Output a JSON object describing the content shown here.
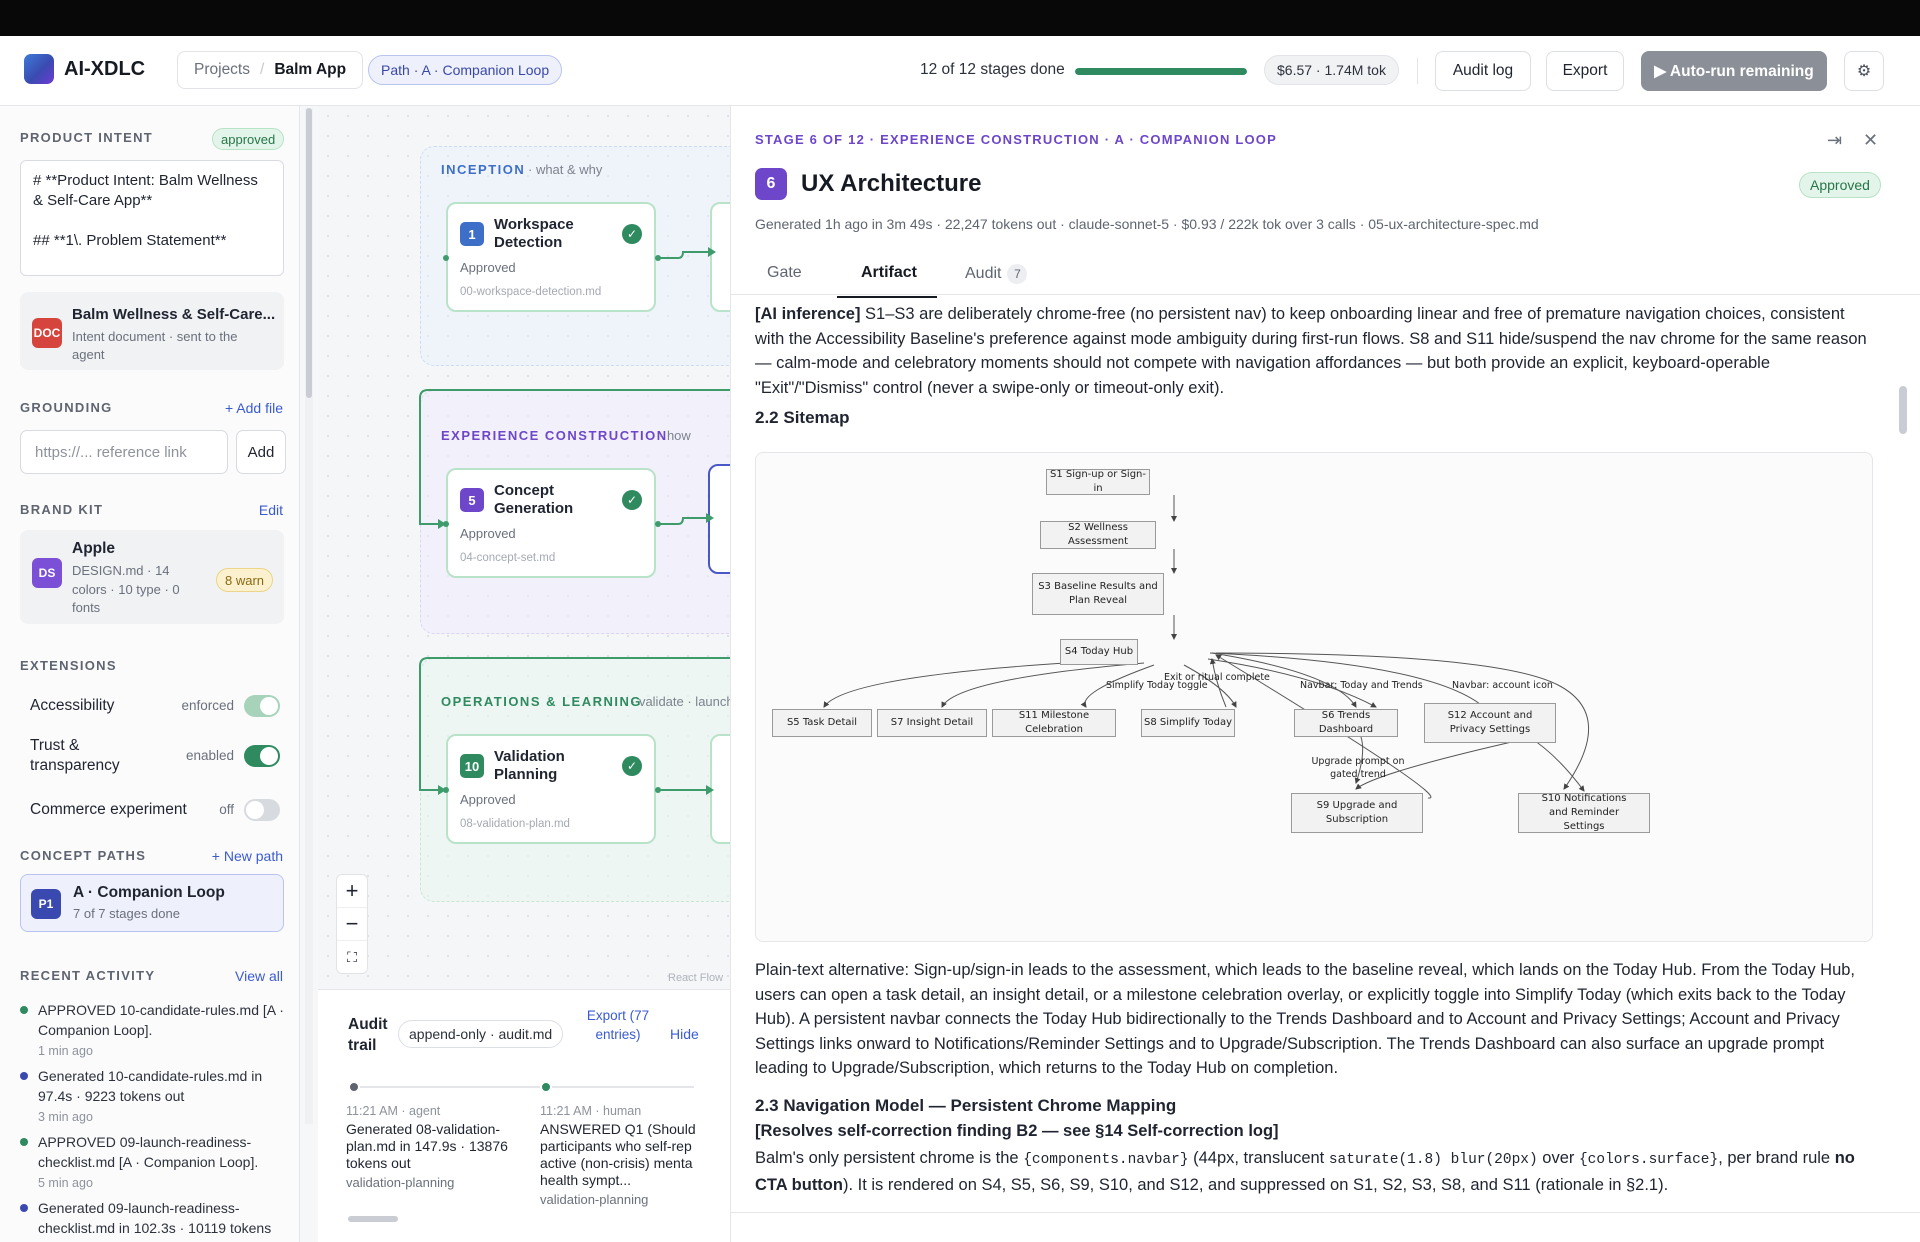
{
  "app": {
    "name": "AI-XDLC"
  },
  "breadcrumb": {
    "projects": "Projects",
    "sep": "/",
    "current": "Balm App"
  },
  "path_pill": "Path · A · Companion Loop",
  "progress": {
    "label": "12 of 12 stages done",
    "fraction": 1.0
  },
  "cost": "$6.57 · 1.74M tok",
  "header_buttons": {
    "audit_log": "Audit log",
    "export": "Export",
    "auto_run": "▶ Auto-run remaining",
    "settings_icon": "⚙"
  },
  "sidebar": {
    "product_intent": {
      "title": "PRODUCT INTENT",
      "badge": "approved",
      "text": "# **Product Intent: Balm Wellness & Self-Care App**\n\n## **1\\. Problem Statement**",
      "doc_icon": "DOC",
      "doc_title": "Balm Wellness & Self-Care...",
      "doc_sub": "Intent document · sent to the agent"
    },
    "grounding": {
      "title": "GROUNDING",
      "add_file": "+ Add file",
      "placeholder": "https://... reference link",
      "add_label": "Add"
    },
    "brand_kit": {
      "title": "BRAND KIT",
      "edit": "Edit",
      "icon": "DS",
      "name": "Apple",
      "sub": "DESIGN.md · 14 colors · 10 type · 0 fonts",
      "warn": "8 warn"
    },
    "extensions": {
      "title": "EXTENSIONS",
      "items": [
        {
          "label": "Accessibility",
          "status": "enforced"
        },
        {
          "label": "Trust & transparency",
          "status": "enabled"
        },
        {
          "label": "Commerce experiment",
          "status": "off"
        }
      ]
    },
    "concept_paths": {
      "title": "CONCEPT PATHS",
      "new_path": "+ New path",
      "icon": "P1",
      "name": "A · Companion Loop",
      "sub": "7 of 7 stages done"
    },
    "recent_activity": {
      "title": "RECENT ACTIVITY",
      "view_all": "View all",
      "items": [
        {
          "text": "APPROVED 10-candidate-rules.md [A · Companion Loop].",
          "time": "1 min ago",
          "color": "#2f8a5f"
        },
        {
          "text": "Generated 10-candidate-rules.md in 97.4s · 9223 tokens out",
          "time": "3 min ago",
          "color": "#3949b0"
        },
        {
          "text": "APPROVED 09-launch-readiness-checklist.md [A · Companion Loop].",
          "time": "5 min ago",
          "color": "#2f8a5f"
        },
        {
          "text": "Generated 09-launch-readiness-checklist.md in 102.3s · 10119 tokens",
          "time": "",
          "color": "#3949b0"
        }
      ]
    }
  },
  "canvas": {
    "phases": [
      {
        "title": "INCEPTION",
        "sub": "· what & why",
        "color": "#3d6fc9"
      },
      {
        "title": "EXPERIENCE CONSTRUCTION",
        "sub": "· how",
        "color": "#6d46c9"
      },
      {
        "title": "OPERATIONS & LEARNING",
        "sub": "· validate · launch",
        "color": "#2f8a5f"
      }
    ],
    "nodes": [
      {
        "num": "1",
        "title": "Workspace Detection",
        "status": "Approved",
        "file": "00-workspace-detection.md",
        "color": "#3d6fc9"
      },
      {
        "num": "5",
        "title": "Concept Generation",
        "status": "Approved",
        "file": "04-concept-set.md",
        "color": "#6d46c9"
      },
      {
        "num": "10",
        "title": "Validation Planning",
        "status": "Approved",
        "file": "08-validation-plan.md",
        "color": "#2f8a5f"
      }
    ],
    "zoom": {
      "in": "+",
      "out": "−",
      "fit": "⛶"
    },
    "attribution": "React Flow"
  },
  "audit": {
    "title": "Audit trail",
    "pill": "append-only · audit.md",
    "export": "Export (77 entries)",
    "hide": "Hide",
    "entries": [
      {
        "meta": "11:21 AM · agent",
        "body": "Generated 08-validation-plan.md in 147.9s · 13876 tokens out",
        "tag": "validation-planning",
        "color": "#5f6570"
      },
      {
        "meta": "11:21 AM · human",
        "body": "ANSWERED Q1 (Should participants who self-rep active (non-crisis) menta health sympt...",
        "tag": "validation-planning",
        "color": "#2f8a5f"
      }
    ]
  },
  "stage": {
    "overline": "STAGE 6 OF 12 · EXPERIENCE CONSTRUCTION · A · COMPANION LOOP",
    "num": "6",
    "title": "UX Architecture",
    "status": "Approved",
    "meta": "Generated 1h ago in 3m 49s · 22,247 tokens out · claude-sonnet-5 · $0.93 / 222k tok over 3 calls · 05-ux-architecture-spec.md",
    "tabs": [
      {
        "label": "Gate"
      },
      {
        "label": "Artifact"
      },
      {
        "label": "Audit",
        "count": "7"
      }
    ],
    "icons": {
      "collapse": "⇥",
      "close": "✕"
    }
  },
  "artifact": {
    "p1_bold": "[AI inference]",
    "p1": " S1–S3 are deliberately chrome-free (no persistent nav) to keep onboarding linear and free of premature navigation choices, consistent with the Accessibility Baseline's preference against mode ambiguity during first-run flows. S8 and S11 hide/suspend the nav chrome for the same reason — calm-mode and celebratory moments should not compete with navigation affordances — but both provide an explicit, keyboard-operable \"Exit\"/\"Dismiss\" control (never a swipe-only or timeout-only exit).",
    "h_sitemap": "2.2 Sitemap",
    "sitemap": {
      "nodes": [
        "S1 Sign-up or Sign-in",
        "S2 Wellness Assessment",
        "S3 Baseline Results and Plan Reveal",
        "S4 Today Hub",
        "S5 Task Detail",
        "S7 Insight Detail",
        "S11 Milestone Celebration",
        "S8 Simplify Today",
        "S6 Trends Dashboard",
        "S12 Account and Privacy Settings",
        "S9 Upgrade and Subscription",
        "S10 Notifications and Reminder Settings"
      ],
      "labels": [
        "Simplify Today toggle",
        "Exit or ritual complete",
        "Navbar: Today and Trends",
        "Navbar: account icon",
        "Upgrade prompt on gated trend"
      ]
    },
    "p2": "Plain-text alternative: Sign-up/sign-in leads to the assessment, which leads to the baseline reveal, which lands on the Today Hub. From the Today Hub, users can open a task detail, an insight detail, or a milestone celebration overlay, or explicitly toggle into Simplify Today (which exits back to the Today Hub). A persistent navbar connects the Today Hub bidirectionally to the Trends Dashboard and to Account and Privacy Settings; Account and Privacy Settings links onward to Notifications/Reminder Settings and to Upgrade/Subscription. The Trends Dashboard can also surface an upgrade prompt leading to Upgrade/Subscription, which returns to the Today Hub on completion.",
    "h_nav": "2.3 Navigation Model — Persistent Chrome Mapping",
    "resolves": "[Resolves self-correction finding B2 — see §14 Self-correction log]",
    "p3_a": "Balm's only persistent chrome is the ",
    "p3_code1": "{components.navbar}",
    "p3_b": " (44px, translucent ",
    "p3_code2": "saturate(1.8) blur(20px)",
    "p3_c": " over ",
    "p3_code3": "{colors.surface}",
    "p3_d": ", per brand rule ",
    "p3_bold": "no CTA button",
    "p3_e": "). It is rendered on S4, S5, S6, S9, S10, and S12, and suppressed on S1, S2, S3, S8, and S11 (rationale in §2.1)."
  }
}
